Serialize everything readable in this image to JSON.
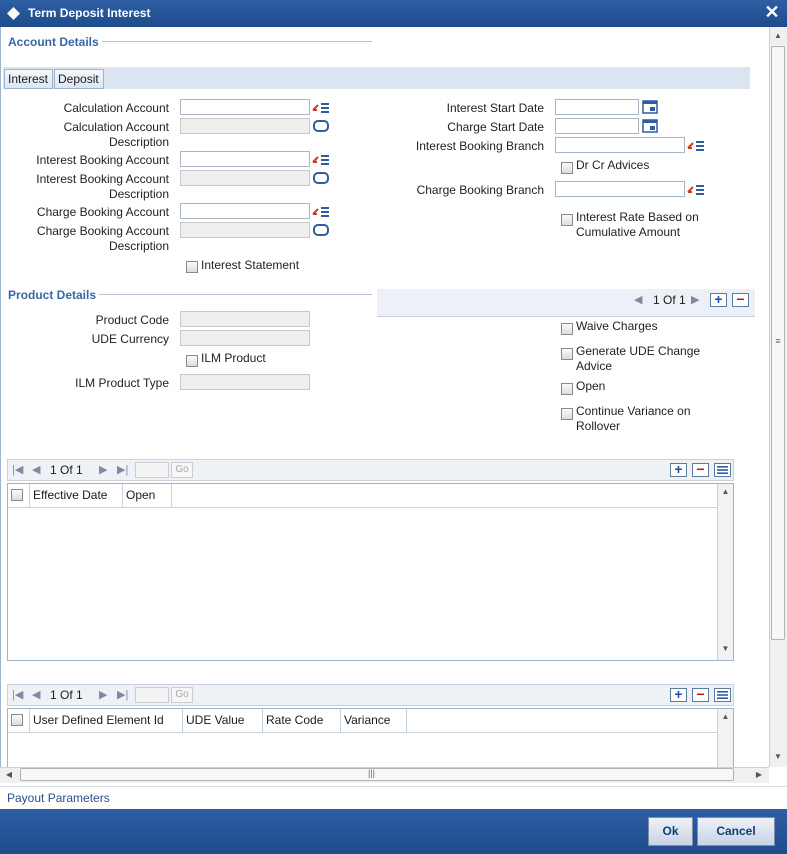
{
  "window": {
    "title": "Term Deposit Interest"
  },
  "account_details": {
    "section_title": "Account Details",
    "tabs": [
      "Interest",
      "Deposit"
    ],
    "left_fields": [
      {
        "label1": "Calculation Account",
        "label2": "",
        "value": "",
        "readonly": false,
        "icon": "lov-icon"
      },
      {
        "label1": "Calculation Account",
        "label2": "Description",
        "value": "",
        "readonly": true,
        "icon": "refresh-icon"
      },
      {
        "label1": "Interest Booking Account",
        "label2": "",
        "value": "",
        "readonly": false,
        "icon": "lov-icon"
      },
      {
        "label1": "Interest Booking Account",
        "label2": "Description",
        "value": "",
        "readonly": true,
        "icon": "refresh-icon"
      },
      {
        "label1": "Charge Booking Account",
        "label2": "",
        "value": "",
        "readonly": false,
        "icon": "lov-icon"
      },
      {
        "label1": "Charge Booking Account",
        "label2": "Description",
        "value": "",
        "readonly": true,
        "icon": "refresh-icon"
      }
    ],
    "interest_statement": "Interest Statement",
    "right_fields": {
      "interest_start_date": "Interest Start Date",
      "charge_start_date": "Charge Start Date",
      "interest_booking_branch": "Interest Booking Branch",
      "dr_cr_advices": "Dr Cr Advices",
      "charge_booking_branch": "Charge Booking Branch",
      "rate_cumulative_1": "Interest Rate Based on",
      "rate_cumulative_2": "Cumulative Amount"
    }
  },
  "product_details": {
    "section_title": "Product Details",
    "product_code": "Product Code",
    "ude_currency": "UDE Currency",
    "ilm_product": "ILM Product",
    "ilm_product_type": "ILM Product Type",
    "pager": "1 Of 1",
    "waive_charges": "Waive Charges",
    "gen_ude_1": "Generate UDE Change",
    "gen_ude_2": "Advice",
    "open": "Open",
    "cont_var_1": "Continue Variance on",
    "cont_var_2": "Rollover"
  },
  "grid1": {
    "pager": "1 Of 1",
    "go": "Go",
    "columns": [
      "Effective Date",
      "Open"
    ]
  },
  "grid2": {
    "pager": "1 Of 1",
    "go": "Go",
    "columns": [
      "User Defined Element Id",
      "UDE Value",
      "Rate Code",
      "Variance"
    ]
  },
  "payout_link": "Payout Parameters",
  "buttons": {
    "ok": "Ok",
    "cancel": "Cancel"
  },
  "colors": {
    "titlebar": "#2a5a9f",
    "section_title": "#3767a6",
    "footer": "#2a5a9f"
  }
}
